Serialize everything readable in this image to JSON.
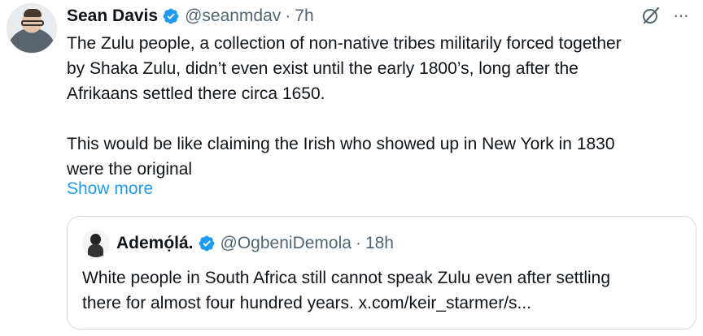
{
  "tweet": {
    "author_name": "Sean Davis",
    "handle": "@seanmdav",
    "separator": "·",
    "time": "7h",
    "text_lines": [
      "The Zulu people, a collection of non-native tribes militarily forced together",
      "by Shaka Zulu, didn’t even exist until the early 1800’s, long after the",
      "Afrikaans settled there circa 1650.",
      "This would be like claiming the Irish who showed up in New York in 1830",
      "were the original"
    ],
    "show_more": "Show more",
    "more_icon": "···"
  },
  "quote": {
    "author_name": "Ademọ́lá.",
    "handle": "@OgbeniDemola",
    "separator": "·",
    "time": "18h",
    "text_lines": [
      "White people in South Africa still cannot speak Zulu even after settling",
      "there for almost four hundred years. x.com/keir_starmer/s..."
    ]
  },
  "colors": {
    "verified": "#1d9bf0",
    "link": "#1d9bf0",
    "secondary_text": "#536471",
    "border": "#cfd9de"
  },
  "icons": [
    "verified-badge-icon",
    "grok-icon",
    "more-icon"
  ]
}
